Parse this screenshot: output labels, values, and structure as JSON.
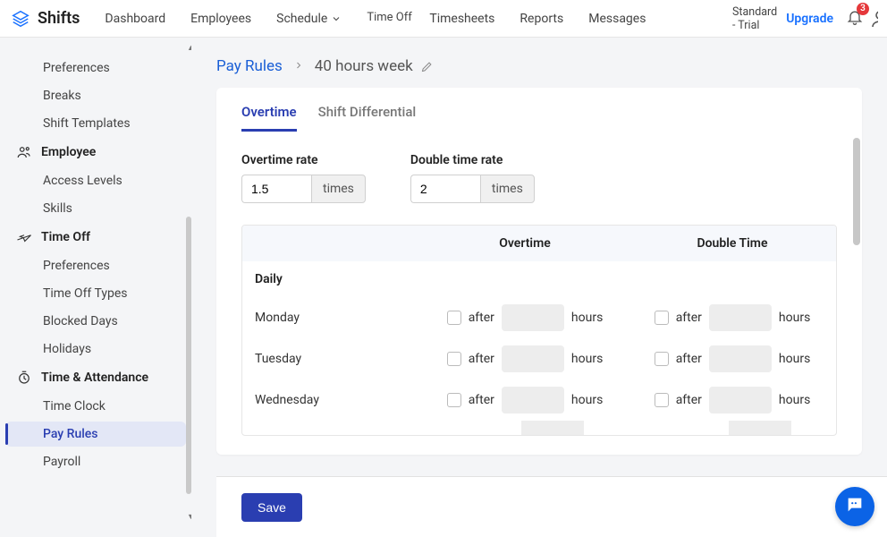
{
  "brand": "Shifts",
  "nav": {
    "dashboard": "Dashboard",
    "employees": "Employees",
    "schedule": "Schedule",
    "timeoff": "Time Off",
    "timesheets": "Timesheets",
    "reports": "Reports",
    "messages": "Messages",
    "plan_line1": "Standard",
    "plan_line2": "- Trial",
    "upgrade": "Upgrade",
    "notifications": "3"
  },
  "sidebar": {
    "preferences": "Preferences",
    "breaks": "Breaks",
    "shift_templates": "Shift Templates",
    "employee_header": "Employee",
    "access_levels": "Access Levels",
    "skills": "Skills",
    "timeoff_header": "Time Off",
    "to_preferences": "Preferences",
    "to_types": "Time Off Types",
    "blocked_days": "Blocked Days",
    "holidays": "Holidays",
    "ta_header": "Time & Attendance",
    "time_clock": "Time Clock",
    "pay_rules": "Pay Rules",
    "payroll": "Payroll"
  },
  "breadcrumb": {
    "root": "Pay Rules",
    "current": "40 hours week"
  },
  "tabs": {
    "overtime": "Overtime",
    "shift_diff": "Shift Differential"
  },
  "form": {
    "ot_rate_label": "Overtime rate",
    "ot_rate_value": "1.5",
    "ot_rate_suffix": "times",
    "dt_rate_label": "Double time rate",
    "dt_rate_value": "2",
    "dt_rate_suffix": "times"
  },
  "table": {
    "head_ot": "Overtime",
    "head_dt": "Double Time",
    "section_daily": "Daily",
    "after": "after",
    "hours": "hours",
    "days": [
      "Monday",
      "Tuesday",
      "Wednesday"
    ]
  },
  "save": "Save"
}
